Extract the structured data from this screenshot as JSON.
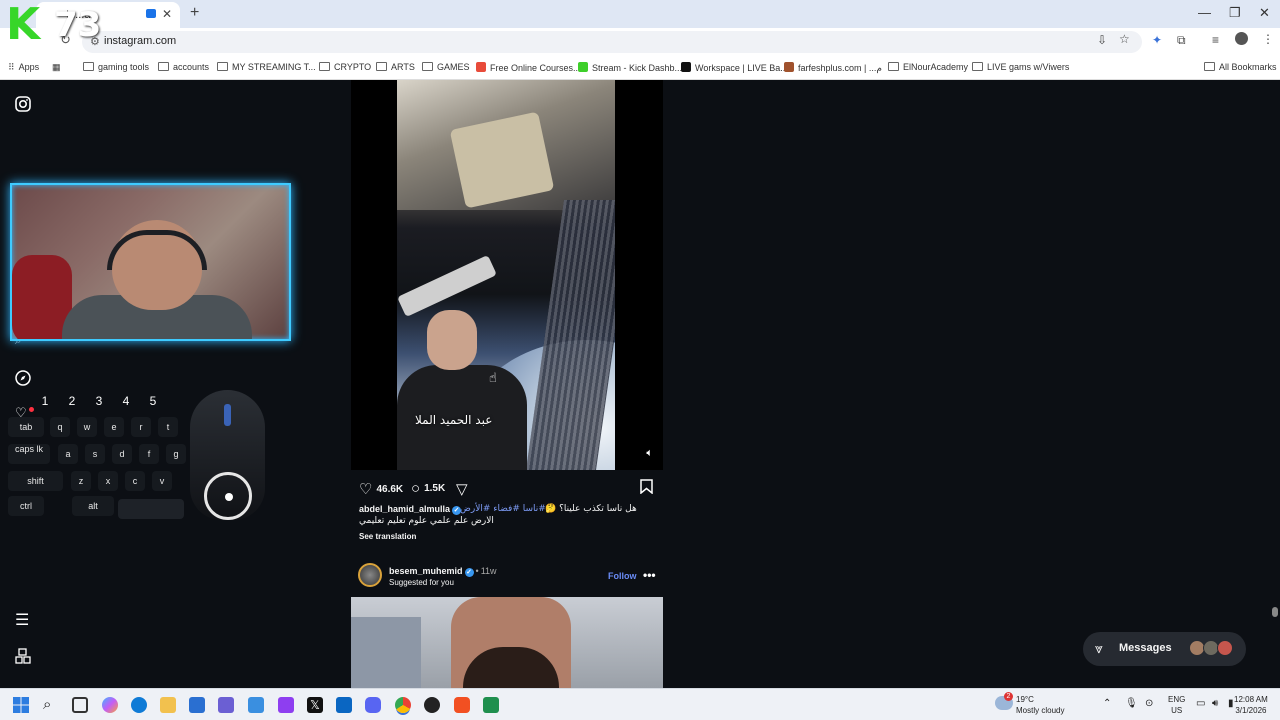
{
  "browser": {
    "tab_title": "In...ar",
    "new_tab": "+",
    "controls": {
      "minimize": "—",
      "restore": "❐",
      "close": "✕"
    },
    "address": "instagram.com"
  },
  "bookmarks": {
    "apps": "Apps",
    "items": [
      "gaming tools",
      "accounts",
      "MY STREAMING T...",
      "CRYPTO",
      "ARTS",
      "GAMES",
      "Free Online Courses...",
      "Stream - Kick Dashb...",
      "Workspace | LIVE Ba...",
      "farfeshplus.com | ...م",
      "ElNourAcademy",
      "LIVE gams w/Viwers"
    ],
    "all": "All Bookmarks"
  },
  "overlay": {
    "logo_letter": "K",
    "logo_number": "73",
    "number_keys": [
      "1",
      "2",
      "3",
      "4",
      "5"
    ],
    "keys_row1": [
      "tab",
      "q",
      "w",
      "e",
      "r",
      "t"
    ],
    "keys_row2": [
      "caps lk",
      "a",
      "s",
      "d",
      "f",
      "g"
    ],
    "keys_row3": [
      "shift",
      "z",
      "x",
      "c",
      "v"
    ],
    "keys_row4": [
      "ctrl",
      "alt",
      ""
    ]
  },
  "post": {
    "video_caption": "عبد الحميد الملا",
    "likes": "46.6K",
    "comments": "1.5K",
    "username": "abdel_hamid_almulla",
    "hashtags": "#ناسا #فضاء #الأرض",
    "caption_line1": "هل ناسا تكذب علينا؟ 🤔",
    "caption_line2": "الارض علم علمي علوم تعليم تعليمي",
    "see_translation": "See translation"
  },
  "next_post": {
    "username": "besem_muhemid",
    "separator": "•",
    "age": "11w",
    "subtitle": "Suggested for you",
    "follow": "Follow",
    "more": "•••"
  },
  "messages": {
    "label": "Messages"
  },
  "taskbar": {
    "weather_badge": "2",
    "weather_temp": "19°C",
    "weather_desc": "Mostly cloudy",
    "lang_top": "ENG",
    "lang_bottom": "US",
    "time": "12:08 AM",
    "date": "3/1/2026"
  },
  "colors": {
    "page_bg": "#0c0f14",
    "accent_link": "#6a8cf7",
    "hashtag": "#7d9bf5",
    "webcam_glow": "#3ecbff",
    "logo_green": "#37d629"
  }
}
